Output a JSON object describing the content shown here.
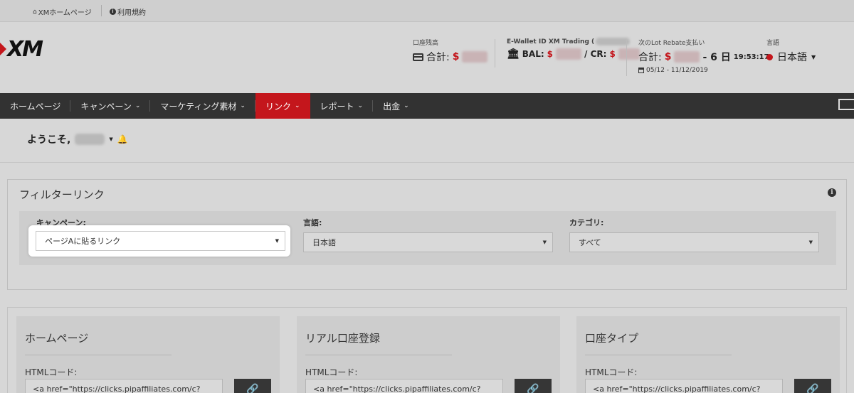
{
  "utilbar": {
    "home_link": "XMホームページ",
    "terms_link": "利用規約"
  },
  "logo": {
    "text": "XM"
  },
  "header": {
    "balance": {
      "label": "口座残高",
      "prefix": "合計:",
      "currency": "$"
    },
    "ewallet": {
      "label": "E-Wallet ID XM Trading (",
      "bal_prefix": "BAL: ",
      "currency": "$",
      "cr_prefix": " / CR: "
    },
    "rebate": {
      "label": "次のLot Rebate支払い",
      "prefix": "合計:",
      "currency": "$",
      "countdown_days": "- 6 日",
      "countdown_time": "19:53:17",
      "period": "05/12 - 11/12/2019"
    },
    "language": {
      "label": "言語",
      "value": "日本語"
    }
  },
  "nav": {
    "items": [
      {
        "label": "ホームページ"
      },
      {
        "label": "キャンペーン"
      },
      {
        "label": "マーケティング素材"
      },
      {
        "label": "リンク"
      },
      {
        "label": "レポート"
      },
      {
        "label": "出金"
      }
    ]
  },
  "welcome": {
    "text": "ようこそ,"
  },
  "filter": {
    "title": "フィルターリンク",
    "campaign": {
      "label": "キャンペーン:",
      "value": "ページAに貼るリンク"
    },
    "language": {
      "label": "言語:",
      "value": "日本語"
    },
    "category": {
      "label": "カテゴリ:",
      "value": "すべて"
    }
  },
  "cards": [
    {
      "title": "ホームページ",
      "code_label": "HTMLコード:",
      "code": "<a href=\"https://clicks.pipaffiliates.com/c?"
    },
    {
      "title": "リアル口座登録",
      "code_label": "HTMLコード:",
      "code": "<a href=\"https://clicks.pipaffiliates.com/c?"
    },
    {
      "title": "口座タイプ",
      "code_label": "HTMLコード:",
      "code": "<a href=\"https://clicks.pipaffiliates.com/c?"
    }
  ],
  "colors": {
    "accent": "#c4161c",
    "nav_bg": "#323232"
  }
}
